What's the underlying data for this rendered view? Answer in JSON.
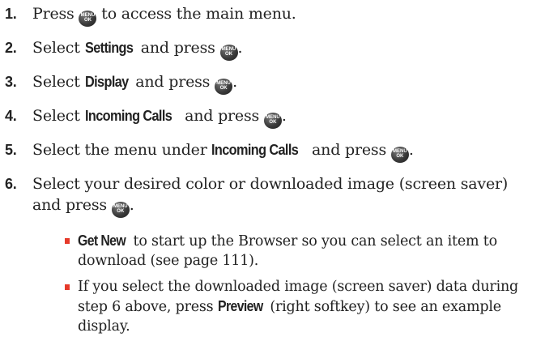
{
  "key_label": {
    "line1": "MENU",
    "line2": "OK"
  },
  "steps": [
    {
      "number": "1.",
      "pre": "Press ",
      "post": " to access the main menu."
    },
    {
      "number": "2.",
      "pre": "Select ",
      "bold": "Settings",
      "mid": " and press ",
      "post": "."
    },
    {
      "number": "3.",
      "pre": "Select ",
      "bold": "Display",
      "mid": " and press ",
      "post": "."
    },
    {
      "number": "4.",
      "pre": "Select ",
      "bold": "Incoming Calls",
      "mid": " and press ",
      "post": "."
    },
    {
      "number": "5.",
      "pre": "Select the menu under ",
      "bold": "Incoming Calls",
      "mid": " and press ",
      "post": "."
    },
    {
      "number": "6.",
      "line1": "Select your desired color or downloaded image (screen saver)",
      "line2_pre": "and press ",
      "post": "."
    }
  ],
  "bullets": [
    {
      "bold": "Get New",
      "text": " to start up the Browser so you can select an item to download (see page 111)."
    },
    {
      "pre": "If you select the downloaded image (screen saver) data during step 6 above, press ",
      "bold": "Preview",
      "post": " (right softkey) to see an example display."
    }
  ],
  "colors": {
    "text": "#222222",
    "bullet": "#e63a2a",
    "key_button": "#2b2b2b"
  },
  "icons": {
    "menu_key": "menu-ok-key-icon",
    "bullet": "red-square-bullet-icon"
  }
}
